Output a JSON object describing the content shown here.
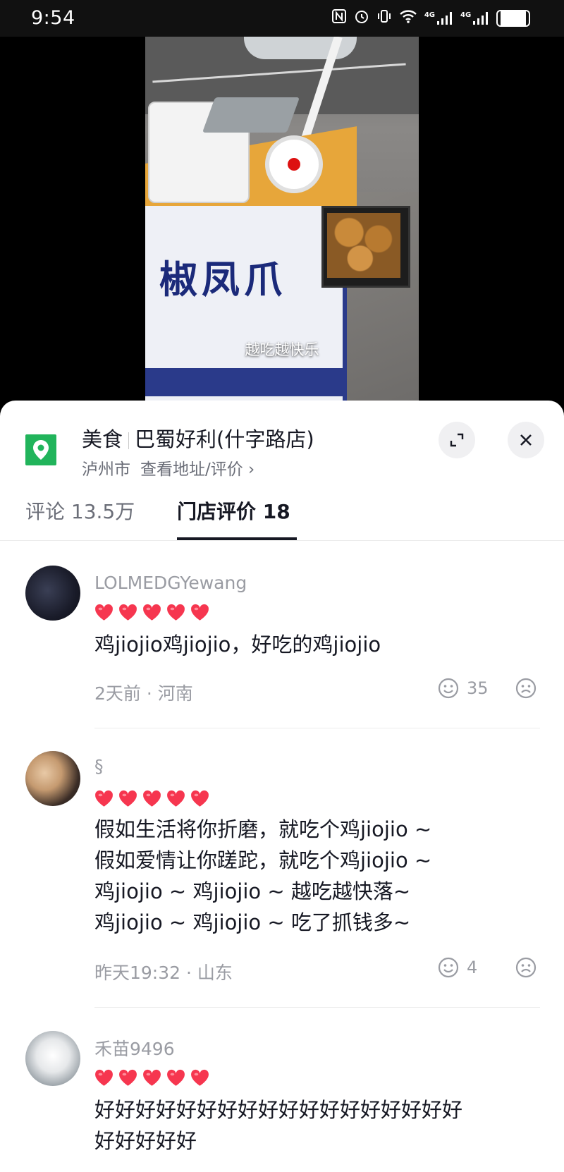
{
  "status_bar": {
    "time": "9:54",
    "icons": [
      "nfc-icon",
      "alarm-icon",
      "vibrate-icon",
      "wifi-icon",
      "signal-4g-icon",
      "signal-4g-icon"
    ],
    "net1": "4G",
    "net2": "4G",
    "battery": "80"
  },
  "video": {
    "caption": "越吃越快乐",
    "sign_text": "椒凤爪"
  },
  "location": {
    "category": "美食",
    "shop_name": "巴蜀好利(什字路店)",
    "city": "泸州市",
    "link": "查看地址/评价 ›",
    "pin_color": "#21b45b"
  },
  "tabs": [
    {
      "label": "评论 13.5万",
      "active": false
    },
    {
      "label": "门店评价 18",
      "active": true
    }
  ],
  "reviews": [
    {
      "username": "LOLMEDGYewang",
      "rating": 5,
      "text_lines": [
        "鸡jiojio鸡jiojio，好吃的鸡jiojio"
      ],
      "meta": "2天前 · 河南",
      "likes": "35"
    },
    {
      "username": "§",
      "rating": 5,
      "text_lines": [
        "假如生活将你折磨，就吃个鸡jiojio ~",
        "假如爱情让你蹉跎，就吃个鸡jiojio ~",
        "鸡jiojio ~ 鸡jiojio ~ 越吃越快落~",
        "鸡jiojio ~ 鸡jiojio ~ 吃了抓钱多~"
      ],
      "meta": "昨天19:32 · 山东",
      "likes": "4"
    },
    {
      "username": "禾苗9496",
      "rating": 5,
      "text_lines": [
        "好好好好好好好好好好好好好好好好好好",
        "好好好好好"
      ],
      "meta": "",
      "likes": ""
    }
  ],
  "colors": {
    "heart": "#f6364f",
    "accent_text": "#161823",
    "muted_text": "#9a9ca3"
  }
}
